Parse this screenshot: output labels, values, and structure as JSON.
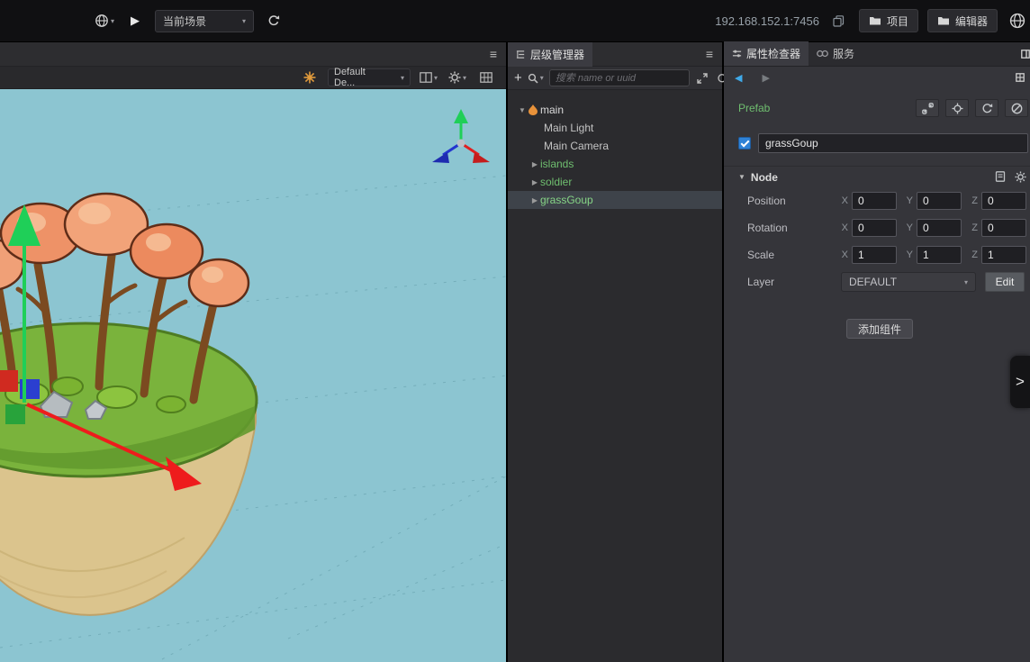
{
  "colors": {
    "prefab_green": "#6fbe6f",
    "selection_bg": "#3e434a",
    "checkbox_blue": "#2f82d6",
    "scene_sky": "#8cc5d1",
    "panel_bg": "#2b2b2e",
    "inspector_bg": "#35353a"
  },
  "icons": {
    "menu": "≡",
    "caret": "▾",
    "play": "▶",
    "plus": "+",
    "back": "◀",
    "forward": "▶",
    "tree_expanded": "▼",
    "tree_collapsed": "▶",
    "section_open": "▼",
    "chevron_right": ">"
  },
  "topbar": {
    "scene_select": "当前场景",
    "address": "192.168.152.1:7456",
    "project": "项目",
    "editor": "编辑器"
  },
  "scene": {
    "camera_select": "Default De..."
  },
  "hierarchy": {
    "tab": "层级管理器",
    "search_placeholder": "搜索 name or uuid",
    "tree": [
      {
        "label": "main"
      },
      {
        "label": "Main Light"
      },
      {
        "label": "Main Camera"
      },
      {
        "label": "islands"
      },
      {
        "label": "soldier"
      },
      {
        "label": "grassGoup"
      }
    ]
  },
  "inspector": {
    "tab_inspector": "属性检查器",
    "tab_service": "服务",
    "prefab": "Prefab",
    "name_value": "grassGoup",
    "node_section": "Node",
    "axis": {
      "x": "X",
      "y": "Y",
      "z": "Z"
    },
    "rows": {
      "position": {
        "label": "Position",
        "x": "0",
        "y": "0",
        "z": "0"
      },
      "rotation": {
        "label": "Rotation",
        "x": "0",
        "y": "0",
        "z": "0"
      },
      "scale": {
        "label": "Scale",
        "x": "1",
        "y": "1",
        "z": "1"
      }
    },
    "layer": {
      "label": "Layer",
      "value": "DEFAULT",
      "edit": "Edit"
    },
    "add_component": "添加组件"
  }
}
